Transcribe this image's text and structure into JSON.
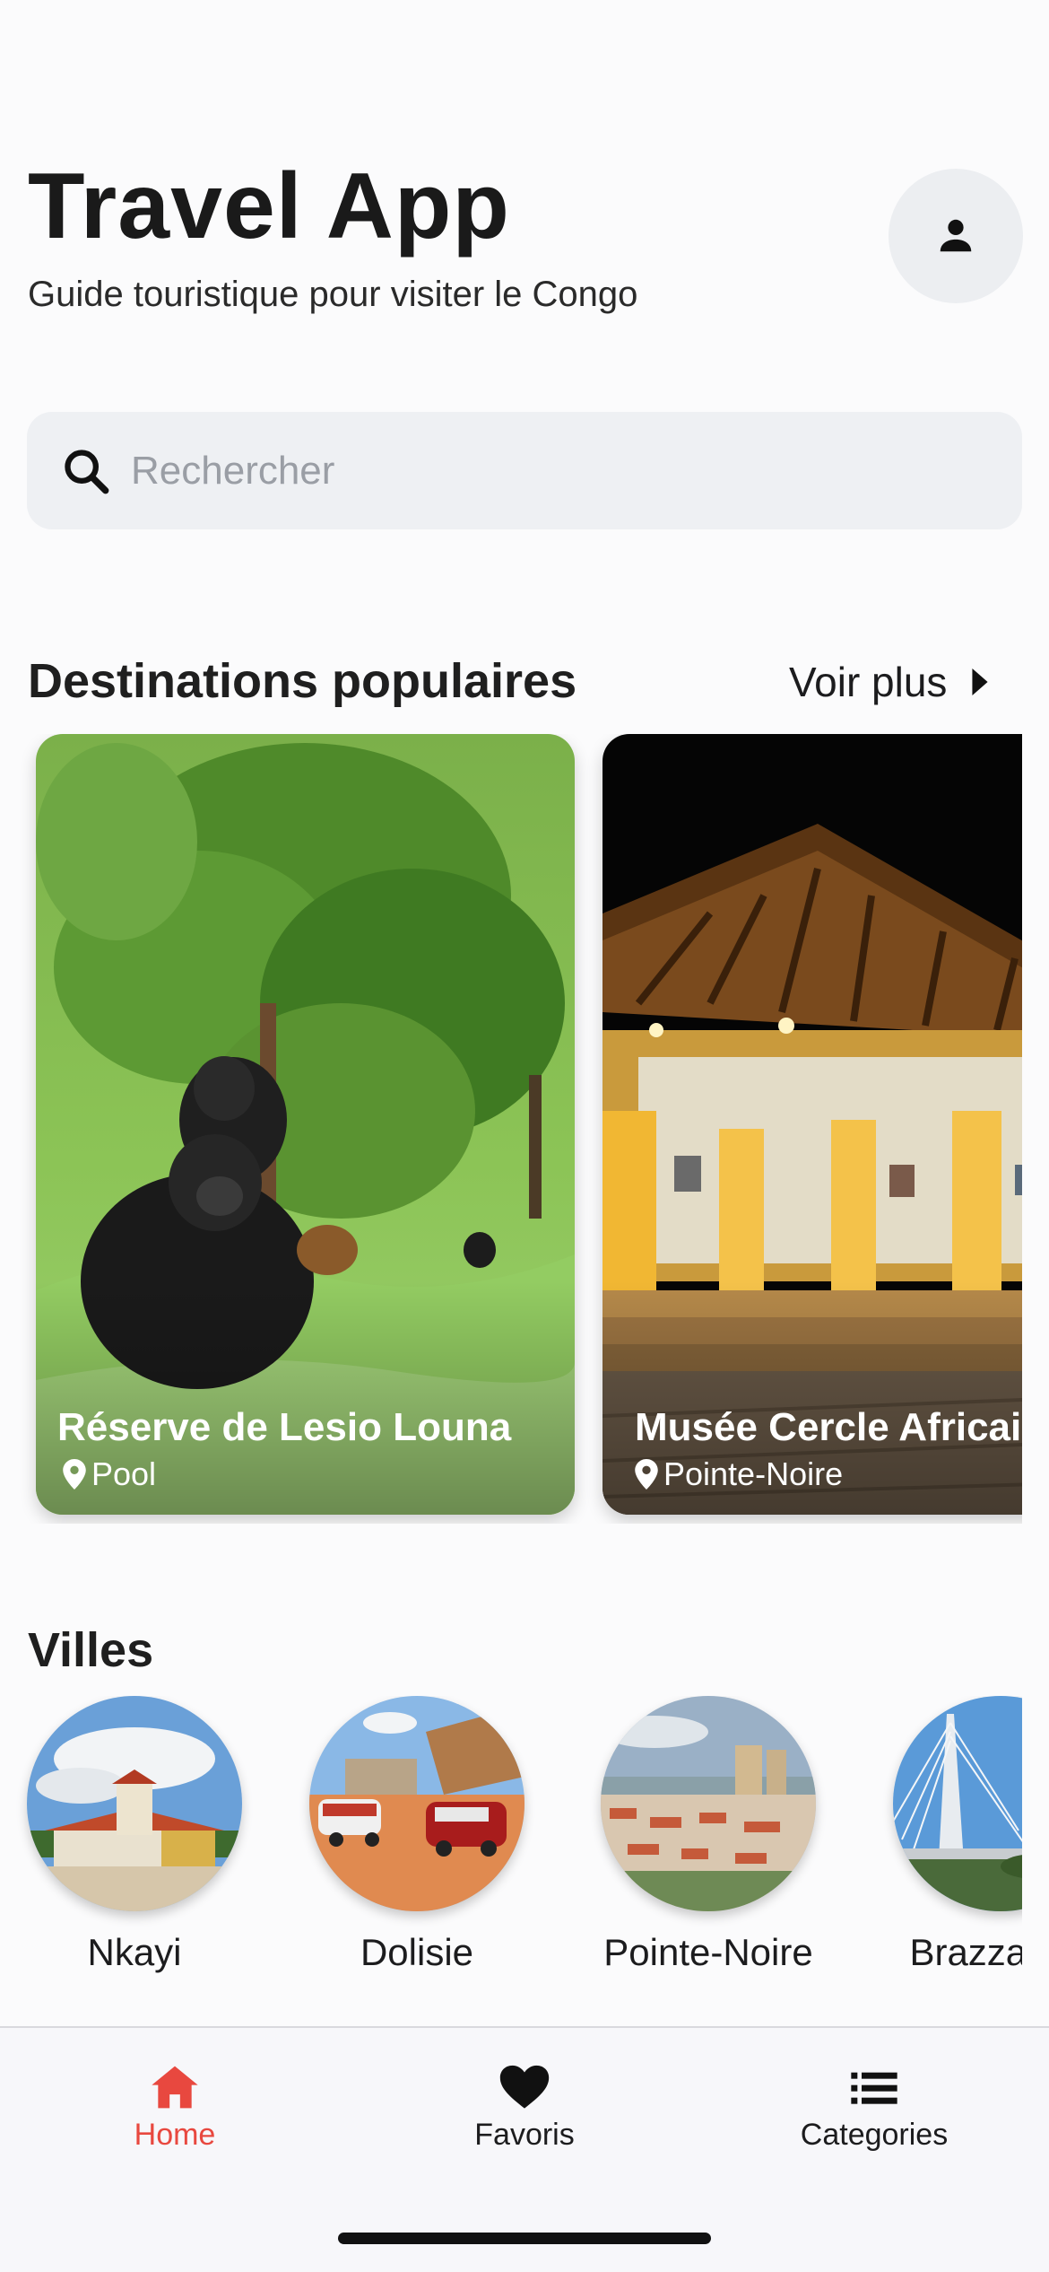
{
  "header": {
    "title": "Travel App",
    "subtitle": "Guide touristique pour visiter le Congo",
    "profile_icon": "person-icon"
  },
  "search": {
    "placeholder": "Rechercher",
    "value": "",
    "icon": "search-icon"
  },
  "popular": {
    "title": "Destinations populaires",
    "see_more": "Voir plus",
    "cards": [
      {
        "title": "Réserve de Lesio Louna",
        "location": "Pool"
      },
      {
        "title": "Musée Cercle Africain",
        "location": "Pointe-Noire"
      }
    ]
  },
  "cities": {
    "title": "Villes",
    "items": [
      {
        "name": "Nkayi"
      },
      {
        "name": "Dolisie"
      },
      {
        "name": "Pointe-Noire"
      },
      {
        "name": "Brazzaville"
      }
    ]
  },
  "bottom_nav": {
    "items": [
      {
        "label": "Home",
        "icon": "home-icon",
        "active": true
      },
      {
        "label": "Favoris",
        "icon": "heart-icon",
        "active": false
      },
      {
        "label": "Categories",
        "icon": "list-icon",
        "active": false
      }
    ]
  },
  "colors": {
    "accent": "#e8483f",
    "background": "#fbfbfc",
    "search_bg": "#eef0f3"
  }
}
